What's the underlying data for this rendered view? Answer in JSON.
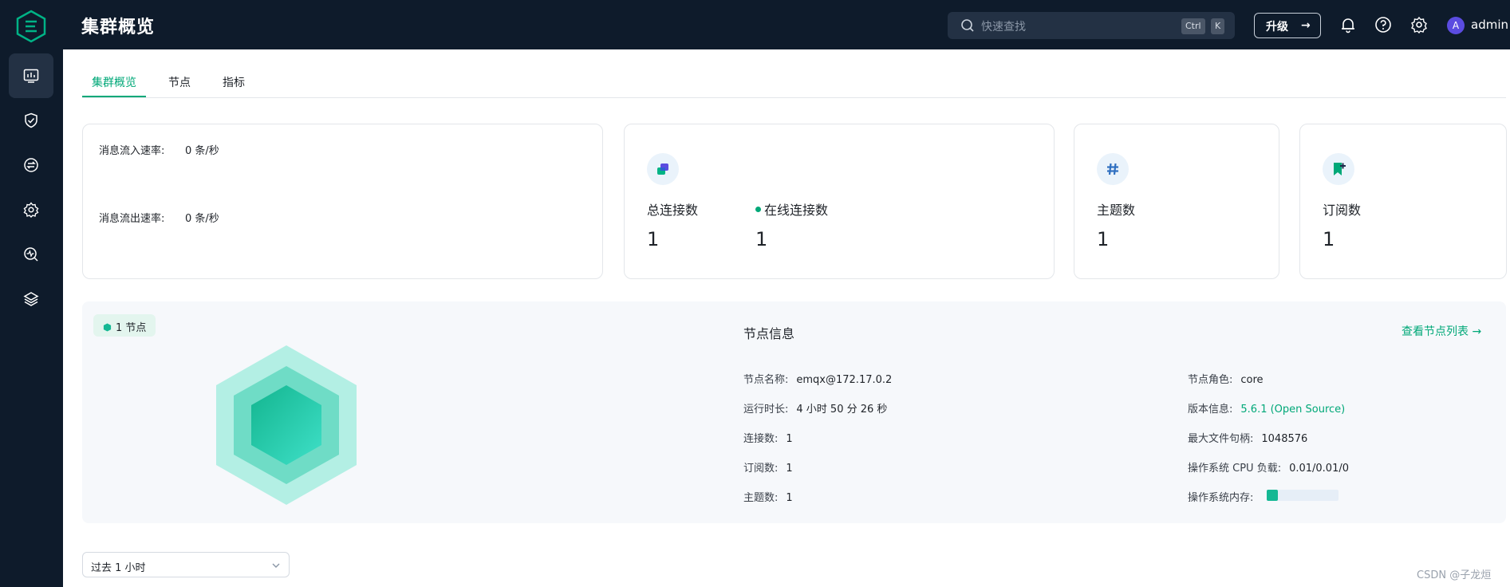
{
  "app": {
    "title": "集群概览",
    "logo_icon": "emqx-logo-icon"
  },
  "header": {
    "search_placeholder": "快速查找",
    "shortcut_ctrl": "Ctrl",
    "shortcut_k": "K",
    "upgrade_label": "升级",
    "upgrade_arrow": "→",
    "bell_icon": "bell-icon",
    "help_icon": "help-icon",
    "settings_icon": "gear-icon",
    "avatar_letter": "A",
    "username": "admin"
  },
  "sidebar": {
    "items": [
      {
        "icon": "dashboard-icon",
        "active": true
      },
      {
        "icon": "shield-check-icon"
      },
      {
        "icon": "integration-icon"
      },
      {
        "icon": "gear-management-icon"
      },
      {
        "icon": "monitor-search-icon"
      },
      {
        "icon": "layers-icon"
      }
    ]
  },
  "tabs": [
    {
      "label": "集群概览",
      "active": true
    },
    {
      "label": "节点"
    },
    {
      "label": "指标"
    }
  ],
  "rates": {
    "in_label": "消息流入速率:",
    "in_value": "0 条/秒",
    "out_label": "消息流出速率:",
    "out_value": "0 条/秒"
  },
  "stats": {
    "total_connections_label": "总连接数",
    "total_connections_value": "1",
    "online_connections_label": "在线连接数",
    "online_connections_value": "1",
    "topics_label": "主题数",
    "topics_value": "1",
    "subscriptions_label": "订阅数",
    "subscriptions_value": "1"
  },
  "node": {
    "badge": "1 节点",
    "info_title": "节点信息",
    "view_list_link": "查看节点列表 →",
    "left": [
      {
        "key": "节点名称:",
        "value": "emqx@172.17.0.2"
      },
      {
        "key": "运行时长:",
        "value": "4 小时 50 分 26 秒"
      },
      {
        "key": "连接数:",
        "value": "1"
      },
      {
        "key": "订阅数:",
        "value": "1"
      },
      {
        "key": "主题数:",
        "value": "1"
      }
    ],
    "right": [
      {
        "key": "节点角色:",
        "value": "core"
      },
      {
        "key": "版本信息:",
        "value": "5.6.1 (Open Source)"
      },
      {
        "key": "最大文件句柄:",
        "value": "1048576"
      },
      {
        "key": "操作系统 CPU 负载:",
        "value": "0.01/0.01/0"
      },
      {
        "key": "操作系统内存:",
        "value": ""
      }
    ],
    "memory_usage_fraction": 0.16,
    "accent_color": "#00a878"
  },
  "time_range": {
    "value": "过去 1 小时"
  },
  "watermark": "CSDN @子龙烜"
}
